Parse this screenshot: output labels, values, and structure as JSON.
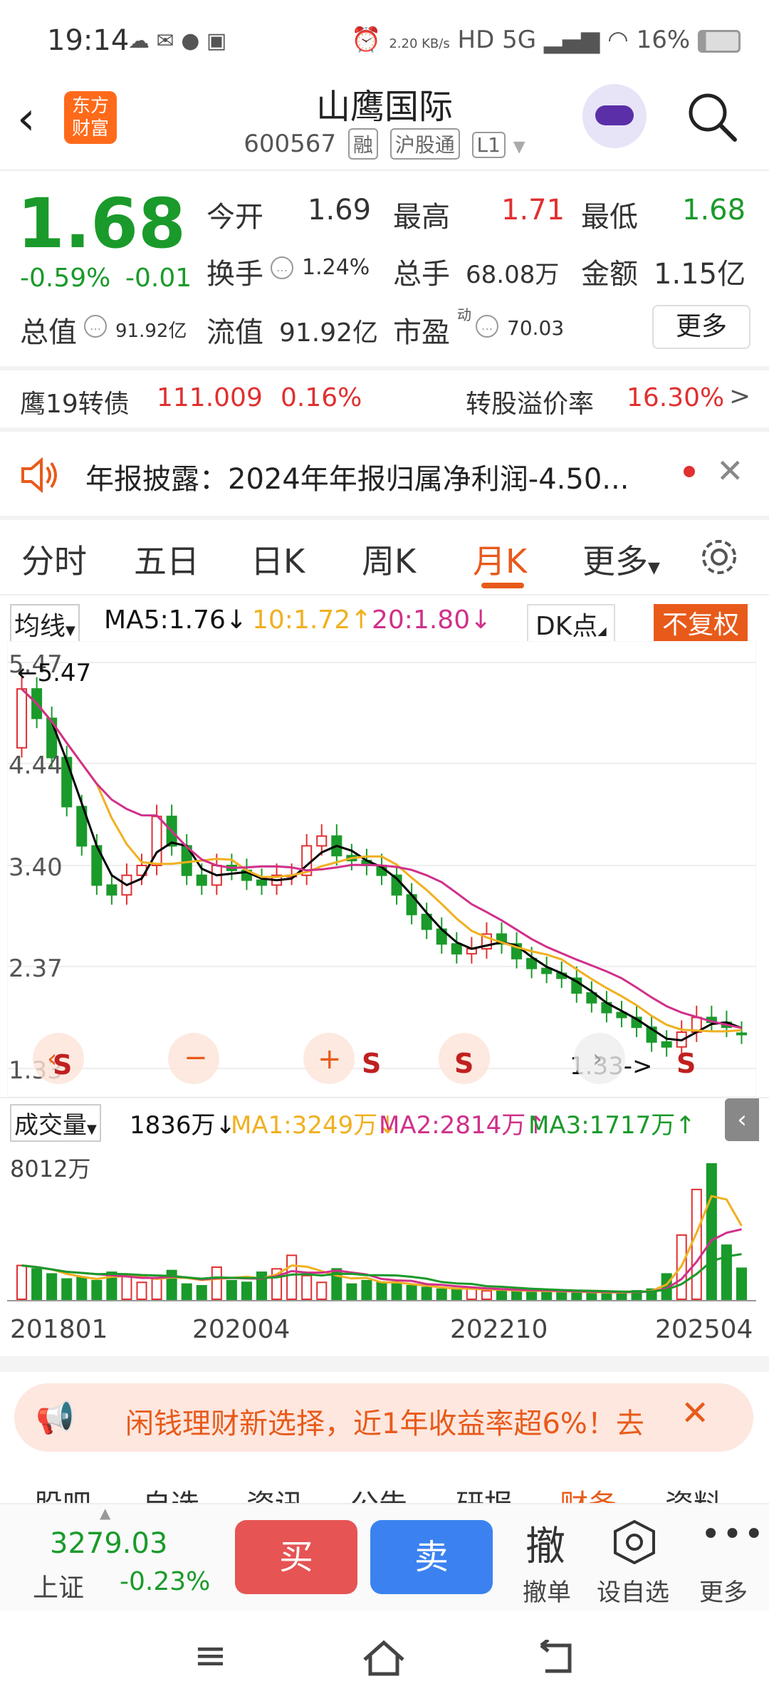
{
  "status_bar": {
    "time": "19:14",
    "net_speed": "2.20 KB/s",
    "battery": "16%"
  },
  "header": {
    "title": "山鹰国际",
    "code": "600567",
    "tags": [
      "融",
      "沪股通",
      "L1"
    ],
    "logo_text": [
      "东方",
      "财富"
    ]
  },
  "quote": {
    "price": "1.68",
    "change_pct": "-0.59%",
    "change": "-0.01",
    "open_label": "今开",
    "open": "1.69",
    "high_label": "最高",
    "high": "1.71",
    "low_label": "最低",
    "low": "1.68",
    "turnover_label": "换手",
    "turnover": "1.24%",
    "volume_label": "总手",
    "volume": "68.08万",
    "amount_label": "金额",
    "amount": "1.15亿",
    "mktcap_label": "总值",
    "mktcap": "91.92亿",
    "float_label": "流值",
    "float": "91.92亿",
    "pe_label": "市盈",
    "pe_sup": "动",
    "pe": "70.03",
    "more": "更多"
  },
  "bond": {
    "name": "鹰19转债",
    "price": "111.009",
    "pct": "0.16%",
    "premium_label": "转股溢价率",
    "premium": "16.30%"
  },
  "notice": {
    "text": "年报披露：2024年年报归属净利润-4.50..."
  },
  "tabs": {
    "items": [
      "分时",
      "五日",
      "日K",
      "周K",
      "月K",
      "更多"
    ],
    "active": "月K"
  },
  "kline": {
    "ma_selector": "均线",
    "ma5": "MA5:1.76↓",
    "ma10": "10:1.72↑",
    "ma20": "20:1.80↓",
    "dk": "DK点",
    "fq": "不复权",
    "y_ticks": [
      "5.47",
      "4.44",
      "3.40",
      "2.37",
      "1.33"
    ],
    "max_label": "←5.47",
    "min_label": "1.33->",
    "signal": "S"
  },
  "volume": {
    "selector": "成交量",
    "vol": "1836万↓",
    "ma1": "MA1:3249万↓",
    "ma2": "MA2:2814万↑",
    "ma3": "MA3:1717万↑",
    "max": "8012万",
    "x_ticks": [
      "201801",
      "202004",
      "202210",
      "202504"
    ]
  },
  "colors": {
    "up": "#e03030",
    "down": "#1a9a2a",
    "ma5": "#000000",
    "ma10": "#f0b020",
    "ma20": "#d0308a",
    "accent": "#e85a1a"
  },
  "ad": {
    "text": "闲钱理财新选择，近1年收益率超6%！去"
  },
  "bottom": {
    "index_value": "3279.03",
    "index_name": "上证",
    "index_pct": "-0.23%",
    "buy": "买",
    "sell": "卖",
    "cancel": "撤单",
    "cancel_icon": "撤",
    "watch": "设自选",
    "more": "更多"
  },
  "peek_tabs": [
    "股吧",
    "自选",
    "资讯",
    "公告",
    "研报",
    "财务",
    "资料"
  ],
  "chart_data": {
    "type": "candlestick",
    "period": "monthly",
    "x_ticks": [
      "201801",
      "202004",
      "202210",
      "202504"
    ],
    "ylim": [
      1.33,
      5.47
    ],
    "close": [
      5.2,
      4.9,
      4.5,
      4.0,
      3.6,
      3.2,
      3.1,
      3.3,
      3.4,
      3.9,
      3.6,
      3.3,
      3.2,
      3.4,
      3.35,
      3.25,
      3.2,
      3.3,
      3.3,
      3.6,
      3.7,
      3.5,
      3.45,
      3.4,
      3.3,
      3.1,
      2.9,
      2.75,
      2.6,
      2.5,
      2.55,
      2.7,
      2.6,
      2.45,
      2.35,
      2.3,
      2.25,
      2.1,
      2.0,
      1.9,
      1.85,
      1.75,
      1.6,
      1.55,
      1.7,
      1.85,
      1.8,
      1.75,
      1.68
    ],
    "open": [
      4.6,
      5.2,
      4.9,
      4.5,
      4.0,
      3.6,
      3.2,
      3.1,
      3.3,
      3.4,
      3.9,
      3.6,
      3.3,
      3.2,
      3.4,
      3.35,
      3.25,
      3.2,
      3.3,
      3.3,
      3.6,
      3.7,
      3.5,
      3.45,
      3.4,
      3.3,
      3.1,
      2.9,
      2.75,
      2.6,
      2.5,
      2.55,
      2.7,
      2.6,
      2.45,
      2.35,
      2.3,
      2.25,
      2.1,
      2.0,
      1.9,
      1.85,
      1.75,
      1.6,
      1.55,
      1.7,
      1.85,
      1.8,
      1.69
    ],
    "volume": [
      2000,
      1800,
      1500,
      1200,
      1300,
      1100,
      1600,
      1400,
      1000,
      1200,
      1700,
      900,
      800,
      1900,
      1100,
      1000,
      1600,
      1800,
      2600,
      1400,
      1000,
      1800,
      900,
      1100,
      1000,
      900,
      800,
      700,
      600,
      600,
      650,
      500,
      550,
      500,
      450,
      500,
      450,
      400,
      420,
      400,
      380,
      500,
      600,
      1500,
      3800,
      6500,
      8012,
      3200,
      1836
    ]
  }
}
